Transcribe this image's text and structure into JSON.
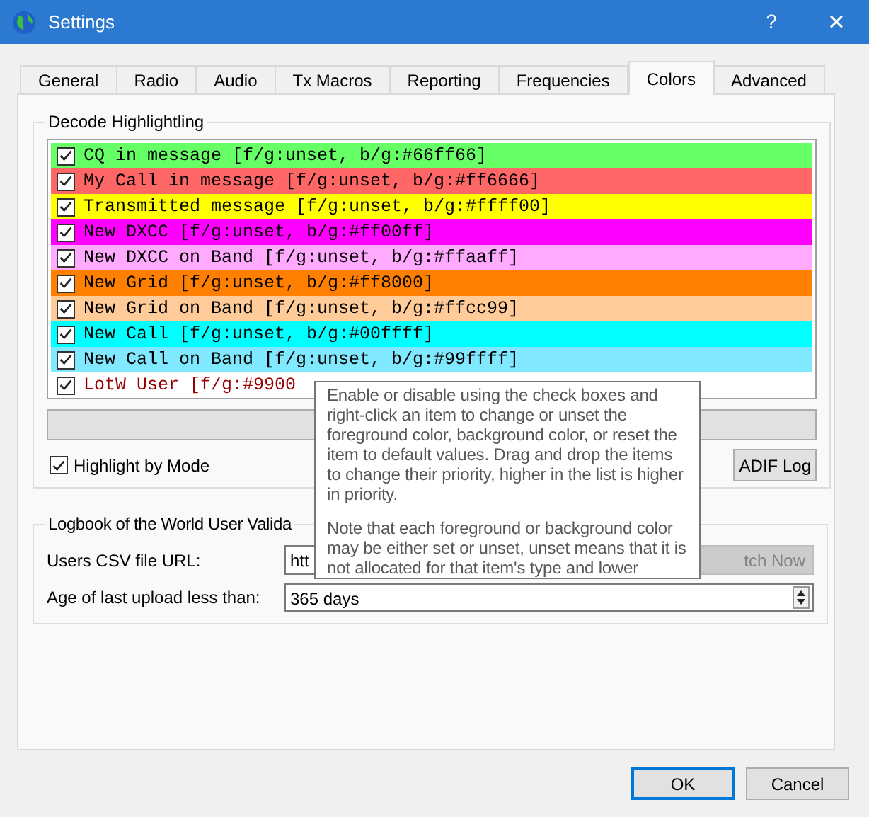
{
  "window": {
    "title": "Settings",
    "help": "?",
    "close": "×"
  },
  "tabs": [
    {
      "label": "General",
      "selected": false
    },
    {
      "label": "Radio",
      "selected": false
    },
    {
      "label": "Audio",
      "selected": false
    },
    {
      "label": "Tx Macros",
      "selected": false
    },
    {
      "label": "Reporting",
      "selected": false
    },
    {
      "label": "Frequencies",
      "selected": false
    },
    {
      "label": "Colors",
      "selected": true
    },
    {
      "label": "Advanced",
      "selected": false
    }
  ],
  "decode_highlighting": {
    "title": "Decode Highlightling",
    "items": [
      {
        "label": "CQ in message [f/g:unset, b/g:#66ff66]",
        "checked": true,
        "kind": "background",
        "color": "#66ff66"
      },
      {
        "label": "My Call in message [f/g:unset, b/g:#ff6666]",
        "checked": true,
        "kind": "background",
        "color": "#ff6666"
      },
      {
        "label": "Transmitted message [f/g:unset, b/g:#ffff00]",
        "checked": true,
        "kind": "background",
        "color": "#ffff00"
      },
      {
        "label": "New DXCC [f/g:unset, b/g:#ff00ff]",
        "checked": true,
        "kind": "background",
        "color": "#ff00ff"
      },
      {
        "label": "New DXCC on Band [f/g:unset, b/g:#ffaaff]",
        "checked": true,
        "kind": "background",
        "color": "#ffaaff"
      },
      {
        "label": "New Grid [f/g:unset, b/g:#ff8000]",
        "checked": true,
        "kind": "background",
        "color": "#ff8000"
      },
      {
        "label": "New Grid on Band [f/g:unset, b/g:#ffcc99]",
        "checked": true,
        "kind": "background",
        "color": "#ffcc99"
      },
      {
        "label": "New Call [f/g:unset, b/g:#00ffff]",
        "checked": true,
        "kind": "background",
        "color": "#00ffff"
      },
      {
        "label": "New Call on Band [f/g:unset, b/g:#99ffff]",
        "checked": true,
        "kind": "background",
        "color": "#80e8ff"
      },
      {
        "label": "LotW User [f/g:#9900",
        "checked": true,
        "kind": "foreground",
        "color": "#990000"
      }
    ],
    "highlight_by_mode": {
      "label": "Highlight by Mode",
      "checked": true
    },
    "adif_button": "ADIF Log"
  },
  "lotw": {
    "title": "Logbook of the World User Valida",
    "url_label": "Users CSV file URL:",
    "url_value": "htt",
    "fetch_button": "tch Now",
    "age_label": "Age of last upload less than:",
    "age_value": "365 days"
  },
  "tooltip": {
    "paragraphs": [
      "Enable or disable using the check boxes and right-click an item to change or unset the foreground color, background color, or reset the item to default values. Drag and drop the items to change their priority, higher in the list is higher in priority.",
      "Note that each foreground or background color may be either set or unset, unset means that it is not allocated for that item's type and lower"
    ]
  },
  "buttons": [
    {
      "label": "OK",
      "default": true
    },
    {
      "label": "Cancel",
      "default": false
    }
  ]
}
